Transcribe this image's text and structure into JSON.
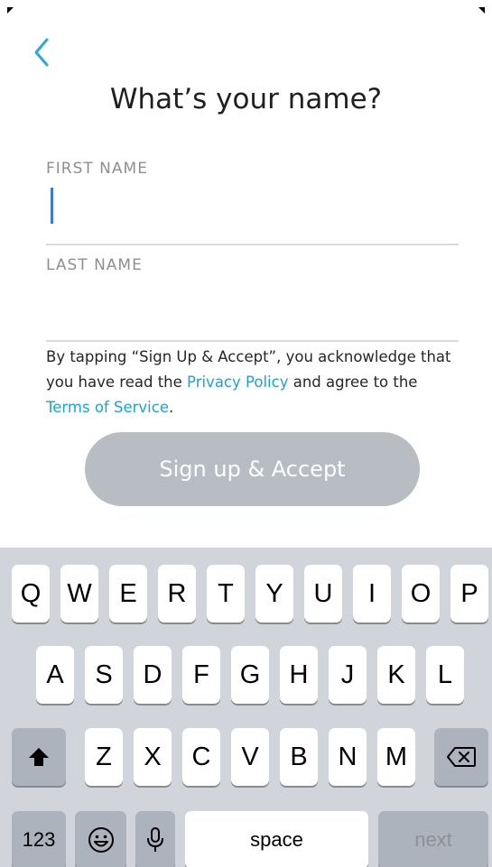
{
  "header": {
    "back_icon": "chevron-left-icon",
    "title": "What’s your name?"
  },
  "form": {
    "first_name": {
      "label": "FIRST NAME",
      "value": "",
      "placeholder": ""
    },
    "last_name": {
      "label": "LAST NAME",
      "value": "",
      "placeholder": ""
    }
  },
  "legal": {
    "text_1": "By tapping “Sign Up & Accept”, you acknowledge that you have read the ",
    "privacy_link": "Privacy Policy",
    "text_2": " and agree to the ",
    "terms_link": "Terms of Service",
    "text_3": "."
  },
  "signup_button": {
    "label": "Sign up & Accept"
  },
  "keyboard": {
    "row1": [
      "Q",
      "W",
      "E",
      "R",
      "T",
      "Y",
      "U",
      "I",
      "O",
      "P"
    ],
    "row2": [
      "A",
      "S",
      "D",
      "F",
      "G",
      "H",
      "J",
      "K",
      "L"
    ],
    "row3": [
      "Z",
      "X",
      "C",
      "V",
      "B",
      "N",
      "M"
    ],
    "numbers_label": "123",
    "space_label": "space",
    "next_label": "next",
    "shift_icon": "shift-icon",
    "delete_icon": "delete-icon",
    "emoji_icon": "emoji-icon",
    "mic_icon": "microphone-icon"
  },
  "colors": {
    "accent_link": "#1aa3d9",
    "back_chevron": "#2aa8e0",
    "caret": "#3b78e7",
    "button_disabled": "#b8bdc3",
    "keyboard_bg": "#d1d5db"
  }
}
